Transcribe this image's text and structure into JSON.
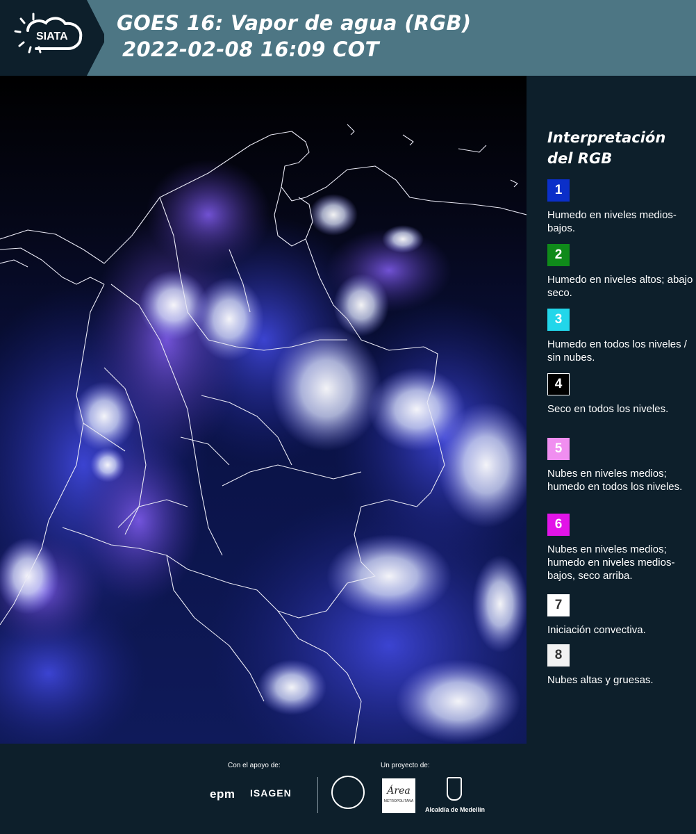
{
  "header": {
    "logo_text": "SIATA",
    "title_line1": "GOES 16: Vapor de agua (RGB)",
    "title_line2": "2022-02-08 16:09 COT"
  },
  "map": {
    "description_icon": "satellite-water-vapor-map"
  },
  "legend": {
    "title_line1": "Interpretación",
    "title_line2": "del RGB",
    "items": [
      {
        "number": "1",
        "text": "Humedo en niveles medios-bajos.",
        "color": "#0b2fc9",
        "num_color": "#ffffff"
      },
      {
        "number": "2",
        "text": "Humedo en niveles altos; abajo seco.",
        "color": "#0f8a1a",
        "num_color": "#ffffff"
      },
      {
        "number": "3",
        "text": "Humedo en todos los niveles / sin nubes.",
        "color": "#22d6ea",
        "num_color": "#ffffff"
      },
      {
        "number": "4",
        "text": "Seco en todos los niveles.",
        "color": "#000000",
        "num_color": "#ffffff"
      },
      {
        "number": "5",
        "text": "Nubes en niveles medios; humedo en todos los niveles.",
        "color": "#f08ef0",
        "num_color": "#ffffff"
      },
      {
        "number": "6",
        "text": "Nubes en niveles medios; humedo en niveles medios-bajos, seco arriba.",
        "color": "#e214e8",
        "num_color": "#ffffff"
      },
      {
        "number": "7",
        "text": "Iniciación convectiva.",
        "color": "#ffffff",
        "num_color": "#333333"
      },
      {
        "number": "8",
        "text": "Nubes altas y gruesas.",
        "color": "#f2f2f2",
        "num_color": "#333333"
      }
    ]
  },
  "footer": {
    "support_label": "Con el apoyo de:",
    "project_label": "Un proyecto de:",
    "epm": "epm",
    "isagen": "ISAGEN",
    "amva": "Área",
    "amva_sub": "METROPOLITANA",
    "alcaldia": "Alcaldía de Medellín"
  }
}
